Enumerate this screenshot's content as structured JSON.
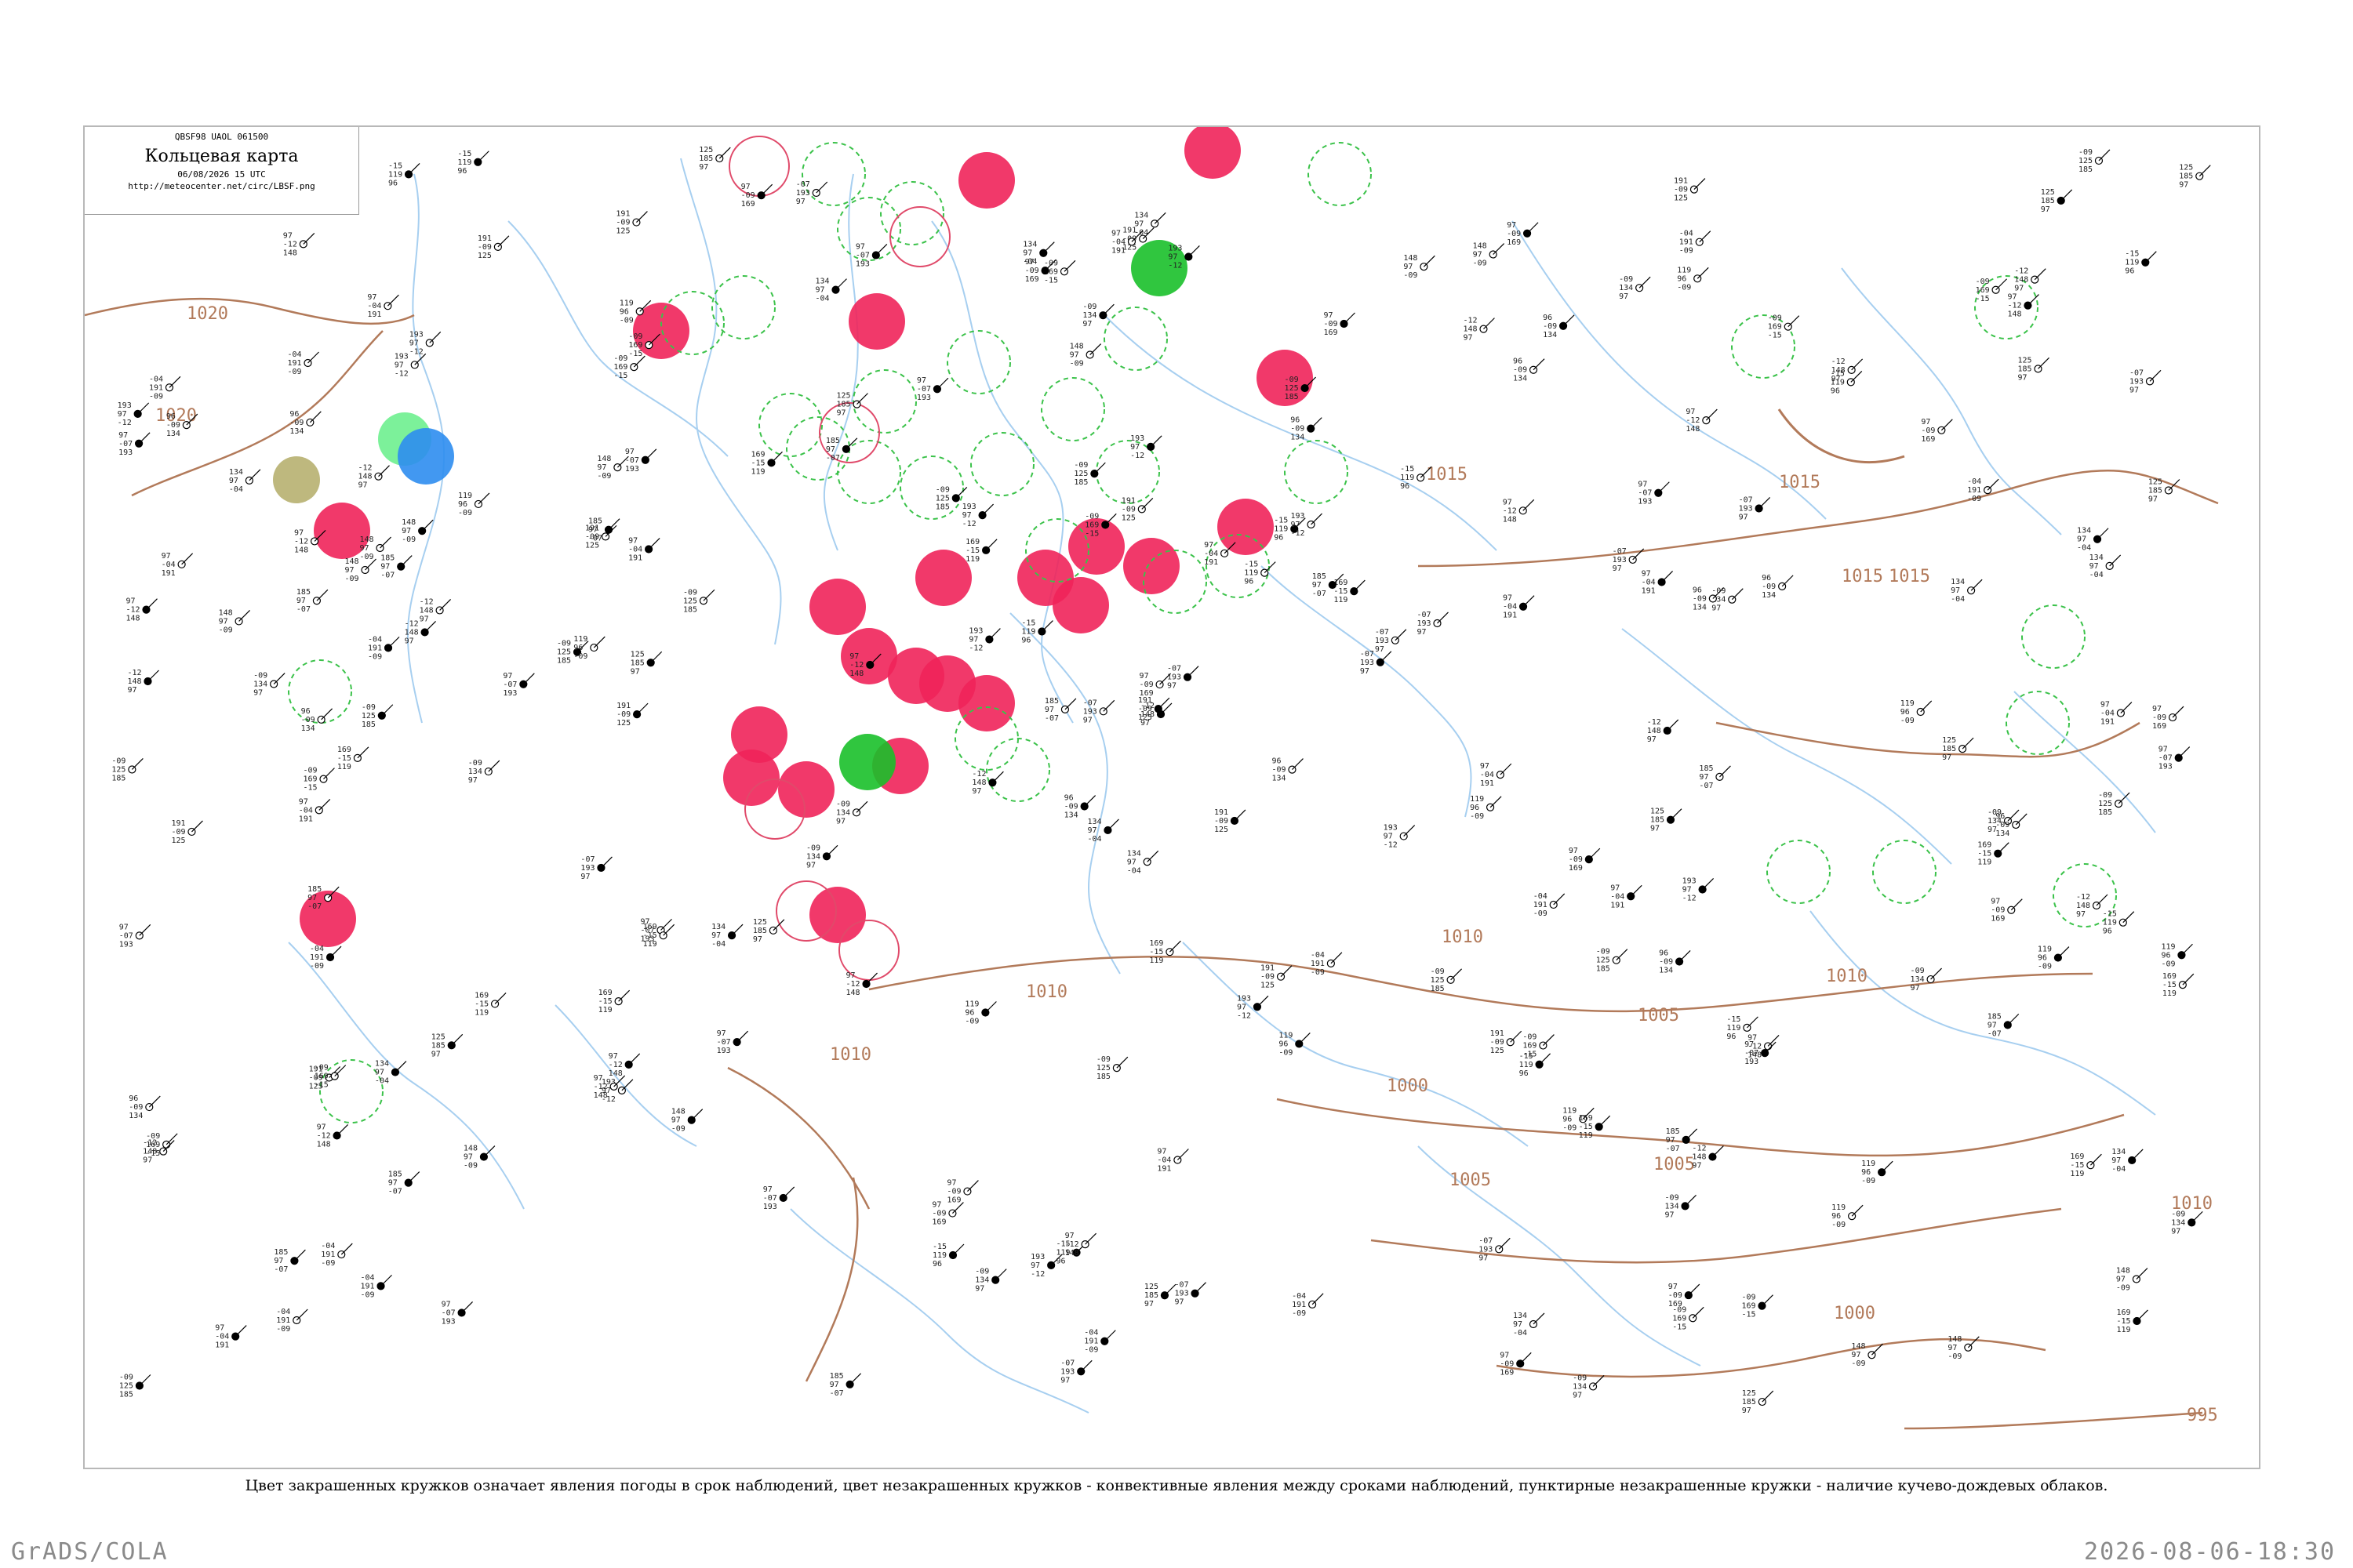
{
  "map": {
    "header_codes": "QBSF98  UAOL  061500",
    "title": "Кольцевая карта",
    "datetime": "06/08/2026 15 UTC",
    "url": "http://meteocenter.net/circ/LBSF.png",
    "caption": "Цвет закрашенных кружков означает явления погоды в срок наблюдений, цвет незакрашенных кружков - конвективные явления между сроками наблюдений, пунктирные незакрашенные кружки - наличие кучево-дождевых облаков.",
    "isobar_labels": [
      "1020",
      "1020",
      "1015",
      "1015",
      "1015",
      "1015",
      "1010",
      "1010",
      "1010",
      "1010",
      "1005",
      "1005",
      "1005",
      "1000",
      "1000",
      "995",
      "1010"
    ],
    "colors": {
      "rain": "#f0245a",
      "thunderstorm": "#19c02a",
      "fog": "#2e8df0",
      "haze": "#b7b070",
      "drizzle": "#6ef08f",
      "cb_dashed": "#3bc24a",
      "convective_ring": "#e04a6a",
      "isobar": "#b27a5a",
      "river": "#a7cff0"
    },
    "sample_station_values": [
      "134",
      "97",
      "-04",
      "191",
      "-09",
      "125",
      "185",
      "97",
      "-07",
      "193",
      "97",
      "-12",
      "148",
      "97",
      "-09",
      "169",
      "-15",
      "119",
      "96",
      "-09"
    ]
  },
  "footer": {
    "left": "GrADS/COLA",
    "right": "2026-08-06-18:30"
  }
}
